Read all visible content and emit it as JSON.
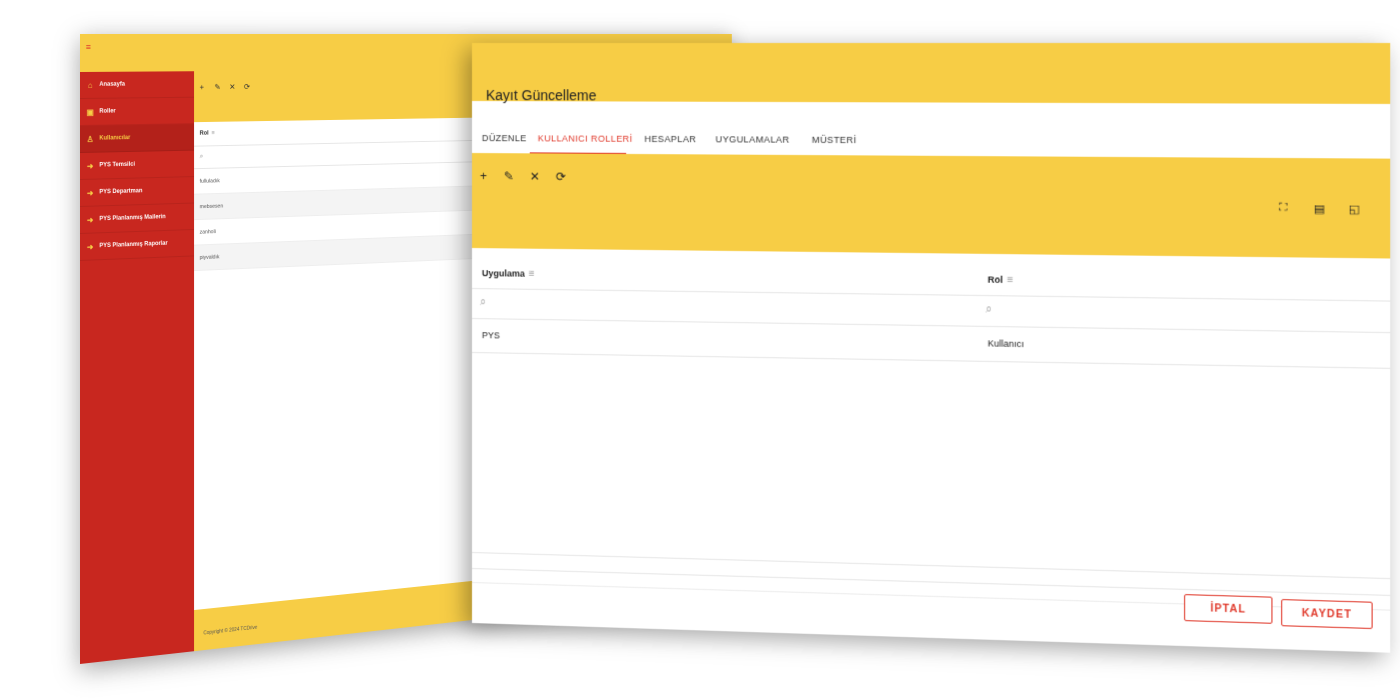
{
  "background_app": {
    "sidebar": {
      "items": [
        {
          "label": "Anasayfa",
          "icon": "home-icon",
          "active": false
        },
        {
          "label": "Roller",
          "icon": "roles-icon",
          "active": false
        },
        {
          "label": "Kullanıcılar",
          "icon": "user-icon",
          "active": true
        },
        {
          "label": "PYS Temsilci",
          "icon": "arrow-icon",
          "active": false
        },
        {
          "label": "PYS Departman",
          "icon": "arrow-icon",
          "active": false
        },
        {
          "label": "PYS Planlanmış Mailerin",
          "icon": "arrow-icon",
          "active": false
        },
        {
          "label": "PYS Planlanmış Raporlar",
          "icon": "arrow-icon",
          "active": false
        }
      ]
    },
    "grid": {
      "column_header": "Rol",
      "rows": [
        "fulluladık",
        "mebsesen",
        "zanholi",
        "piyvaldık"
      ]
    },
    "footer_text": "Copyright © 2024 TCDrive"
  },
  "dialog": {
    "title": "Kayıt Güncelleme",
    "tabs": [
      {
        "label": "DÜZENLE",
        "active": false
      },
      {
        "label": "KULLANICI ROLLERİ",
        "active": true
      },
      {
        "label": "HESAPLAR",
        "active": false
      },
      {
        "label": "UYGULAMALAR",
        "active": false
      },
      {
        "label": "MÜSTERİ",
        "active": false
      }
    ],
    "toolbar": {
      "add_glyph": "+",
      "edit_glyph": "✎",
      "delete_glyph": "✕",
      "refresh_glyph": "⟳",
      "fullscreen_glyph": "⛶",
      "export_glyph": "▤",
      "columns_glyph": "◱"
    },
    "grid": {
      "columns": [
        {
          "title": "Uygulama",
          "filter_glyph": "≡"
        },
        {
          "title": "Rol",
          "filter_glyph": "≡"
        }
      ],
      "search_glyph": "⌕",
      "rows": [
        {
          "uygulama": "PYS",
          "rol": "Kullanıcı"
        }
      ]
    },
    "buttons": {
      "cancel": "İPTAL",
      "save": "KAYDET"
    }
  },
  "colors": {
    "accent_yellow": "#f7cd45",
    "sidebar_red": "#c8271f",
    "active_red": "#e0392b"
  }
}
